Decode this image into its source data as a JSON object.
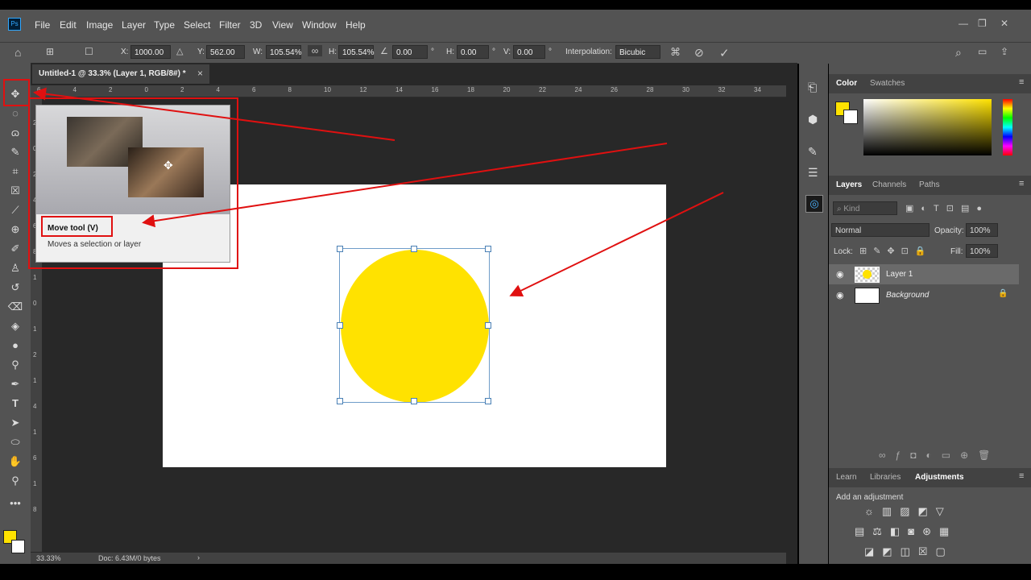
{
  "menu": {
    "logo": "Ps",
    "items": [
      "File",
      "Edit",
      "Image",
      "Layer",
      "Type",
      "Select",
      "Filter",
      "3D",
      "View",
      "Window",
      "Help"
    ],
    "window_controls": [
      "—",
      "❐",
      "✕"
    ]
  },
  "options": {
    "x_label": "X:",
    "x_value": "1000.00 p:",
    "y_label": "Y:",
    "y_value": "562.00 px",
    "w_label": "W:",
    "w_value": "105.54%",
    "h_label": "H:",
    "h_value": "105.54%",
    "angle_value": "0.00",
    "deg": "°",
    "hskew_label": "H:",
    "hskew_value": "0.00",
    "vskew_label": "V:",
    "vskew_value": "0.00",
    "interp_label": "Interpolation:",
    "interp_value": "Bicubic"
  },
  "document": {
    "tab_title": "Untitled-1 @ 33.3% (Layer 1, RGB/8#) *",
    "zoom": "33.33%",
    "doc_info": "Doc: 6.43M/0 bytes",
    "shape_color": "#ffe200"
  },
  "ruler": {
    "top": [
      "6",
      "4",
      "2",
      "0",
      "2",
      "4",
      "6",
      "8",
      "10",
      "12",
      "14",
      "16",
      "18",
      "20",
      "22",
      "24",
      "26",
      "28",
      "30",
      "32",
      "34"
    ],
    "left": [
      "2",
      "0",
      "2",
      "4",
      "6",
      "8",
      "1",
      "0",
      "1",
      "2",
      "1",
      "4",
      "1",
      "6",
      "1",
      "8"
    ]
  },
  "tooltip": {
    "title": "Move tool (V)",
    "description": "Moves a selection or layer"
  },
  "color_panel": {
    "tabs": [
      "Color",
      "Swatches"
    ],
    "foreground": "#ffe200",
    "background": "#ffffff"
  },
  "layers_panel": {
    "tabs": [
      "Layers",
      "Channels",
      "Paths"
    ],
    "filter_label": "Kind",
    "blend_mode": "Normal",
    "opacity_label": "Opacity:",
    "opacity_value": "100%",
    "lock_label": "Lock:",
    "fill_label": "Fill:",
    "fill_value": "100%",
    "layers": [
      {
        "name": "Layer 1",
        "selected": true
      },
      {
        "name": "Background",
        "selected": false
      }
    ]
  },
  "adjust_panel": {
    "tabs": [
      "Learn",
      "Libraries",
      "Adjustments"
    ],
    "hint": "Add an adjustment"
  }
}
